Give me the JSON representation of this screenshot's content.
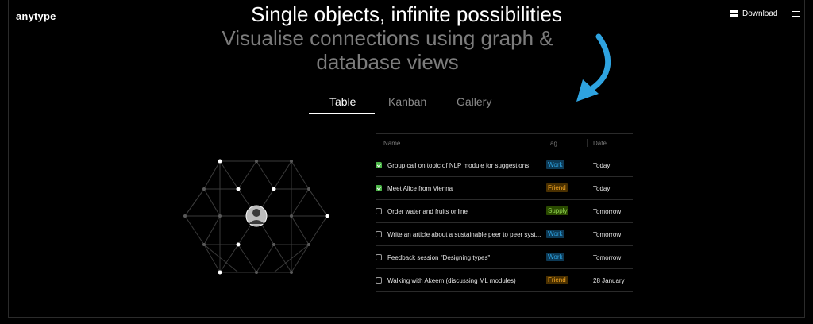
{
  "header": {
    "logo": "anytype",
    "download_label": "Download",
    "download_icon": "grid-icon",
    "menu_icon": "hamburger-icon"
  },
  "hero": {
    "title": "Single objects, infinite possibilities",
    "subtitle_line1": "Visualise connections using graph &",
    "subtitle_line2": "database views",
    "arrow_icon": "curved-arrow-icon",
    "arrow_color": "#2ea3e0"
  },
  "tabs": [
    {
      "label": "Table",
      "active": true
    },
    {
      "label": "Kanban",
      "active": false
    },
    {
      "label": "Gallery",
      "active": false
    }
  ],
  "table": {
    "columns": [
      "Name",
      "Tag",
      "Date"
    ],
    "rows": [
      {
        "checked": true,
        "name": "Group call on topic of NLP module for suggestions",
        "tag": "Work",
        "date": "Today"
      },
      {
        "checked": true,
        "name": "Meet Alice from Vienna",
        "tag": "Friend",
        "date": "Today"
      },
      {
        "checked": false,
        "name": "Order water and fruits online",
        "tag": "Supply",
        "date": "Tomorrow"
      },
      {
        "checked": false,
        "name": "Write an article about a sustainable peer to peer syst...",
        "tag": "Work",
        "date": "Tomorrow"
      },
      {
        "checked": false,
        "name": "Feedback session \"Designing types\"",
        "tag": "Work",
        "date": "Tomorrow"
      },
      {
        "checked": false,
        "name": "Walking with Akeem (discussing ML modules)",
        "tag": "Friend",
        "date": "28 January"
      }
    ]
  },
  "tag_colors": {
    "Work": {
      "bg": "#0d3a56",
      "fg": "#2ea3e0"
    },
    "Friend": {
      "bg": "#4a3000",
      "fg": "#f4a621"
    },
    "Supply": {
      "bg": "#2a4a00",
      "fg": "#8fd34f"
    }
  },
  "graph": {
    "center_node": "avatar"
  }
}
